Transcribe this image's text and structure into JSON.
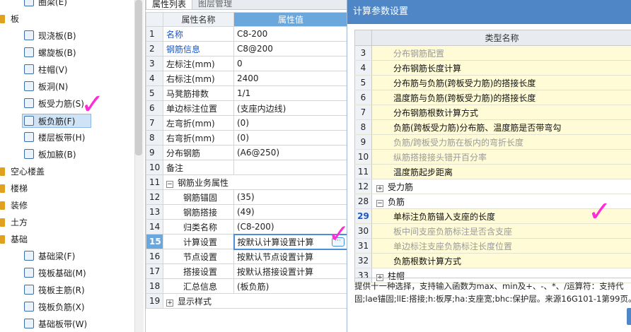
{
  "tree": {
    "items": [
      {
        "label": "圈梁(E)",
        "kind": "child"
      },
      {
        "label": "板",
        "kind": "cat"
      },
      {
        "label": "现浇板(B)",
        "kind": "child"
      },
      {
        "label": "螺旋板(B)",
        "kind": "child"
      },
      {
        "label": "柱帽(V)",
        "kind": "child"
      },
      {
        "label": "板洞(N)",
        "kind": "child"
      },
      {
        "label": "板受力筋(S)",
        "kind": "child"
      },
      {
        "label": "板负筋(F)",
        "kind": "child",
        "selected": true
      },
      {
        "label": "楼层板带(H)",
        "kind": "child"
      },
      {
        "label": "板加腋(B)",
        "kind": "child"
      },
      {
        "label": "空心楼盖",
        "kind": "cat"
      },
      {
        "label": "楼梯",
        "kind": "cat"
      },
      {
        "label": "装修",
        "kind": "cat"
      },
      {
        "label": "土方",
        "kind": "cat"
      },
      {
        "label": "基础",
        "kind": "cat"
      },
      {
        "label": "基础梁(F)",
        "kind": "child"
      },
      {
        "label": "筏板基础(M)",
        "kind": "child"
      },
      {
        "label": "筏板主筋(R)",
        "kind": "child"
      },
      {
        "label": "筏板负筋(X)",
        "kind": "child"
      },
      {
        "label": "基础板带(W)",
        "kind": "child"
      }
    ]
  },
  "props": {
    "tabs": {
      "active": "属性列表",
      "other": "图层管理"
    },
    "header": {
      "name": "属性名称",
      "value": "属性值"
    },
    "rows": [
      {
        "n": "1",
        "name": "名称",
        "value": "C8-200",
        "blue": true
      },
      {
        "n": "2",
        "name": "钢筋信息",
        "value": "C8@200",
        "blue": true
      },
      {
        "n": "3",
        "name": "左标注(mm)",
        "value": "0"
      },
      {
        "n": "4",
        "name": "右标注(mm)",
        "value": "2400"
      },
      {
        "n": "5",
        "name": "马凳筋排数",
        "value": "1/1"
      },
      {
        "n": "6",
        "name": "单边标注位置",
        "value": "(支座内边线)"
      },
      {
        "n": "7",
        "name": "左弯折(mm)",
        "value": "(0)"
      },
      {
        "n": "8",
        "name": "右弯折(mm)",
        "value": "(0)"
      },
      {
        "n": "9",
        "name": "分布钢筋",
        "value": "(A6@250)"
      },
      {
        "n": "10",
        "name": "备注",
        "value": ""
      },
      {
        "n": "11",
        "name": "钢筋业务属性",
        "value": "",
        "group": "−"
      },
      {
        "n": "12",
        "name": "钢筋锚固",
        "value": "(35)",
        "sub": true
      },
      {
        "n": "13",
        "name": "钢筋搭接",
        "value": "(49)",
        "sub": true
      },
      {
        "n": "14",
        "name": "归类名称",
        "value": "(C8-200)",
        "sub": true
      },
      {
        "n": "15",
        "name": "计算设置",
        "value": "按默认计算设置计算",
        "sub": true,
        "current": true
      },
      {
        "n": "16",
        "name": "节点设置",
        "value": "按默认节点设置计算",
        "sub": true
      },
      {
        "n": "17",
        "name": "搭接设置",
        "value": "按默认搭接设置计算",
        "sub": true
      },
      {
        "n": "18",
        "name": "汇总信息",
        "value": "(板负筋)",
        "sub": true
      },
      {
        "n": "19",
        "name": "显示样式",
        "value": "",
        "group": "+"
      }
    ],
    "ellipsis_label": "···"
  },
  "dialog": {
    "title": "计算参数设置",
    "header": "类型名称",
    "rows": [
      {
        "n": "3",
        "text": "分布钢筋配置",
        "gray": true
      },
      {
        "n": "4",
        "text": "分布钢筋长度计算"
      },
      {
        "n": "5",
        "text": "分布筋与负筋(跨板受力筋)的搭接长度"
      },
      {
        "n": "6",
        "text": "温度筋与负筋(跨板受力筋)的搭接长度"
      },
      {
        "n": "7",
        "text": "分布钢筋根数计算方式"
      },
      {
        "n": "8",
        "text": "负筋(跨板受力筋)分布筋、温度筋是否带弯勾"
      },
      {
        "n": "9",
        "text": "负筋/跨板受力筋在板内的弯折长度",
        "gray": true
      },
      {
        "n": "10",
        "text": "纵筋搭接接头错开百分率",
        "gray": true
      },
      {
        "n": "11",
        "text": "温度筋起步距离"
      },
      {
        "n": "12",
        "text": "受力筋",
        "group": "+"
      },
      {
        "n": "28",
        "text": "负筋",
        "group": "−"
      },
      {
        "n": "29",
        "text": "单标注负筋锚入支座的长度",
        "current": true
      },
      {
        "n": "30",
        "text": "板中间支座负筋标注是否含支座",
        "gray": true
      },
      {
        "n": "31",
        "text": "单边标注支座负筋标注长度位置",
        "gray": true
      },
      {
        "n": "32",
        "text": "负筋根数计算方式"
      },
      {
        "n": "33",
        "text": "柱帽",
        "group": "+"
      }
    ],
    "desc_line1": "提供十一种选择，支持输入函数为max、min及+、-、*、/运算符：支持代",
    "desc_line2": "固;lae锚固;llE:搭接;h:板厚;ha:支座宽;bhc:保护层。来源16G101-1第99页。"
  },
  "colors": {
    "accent": "#4f86c6",
    "yellow_row": "#fefbd6",
    "check": "#ff2bd6"
  }
}
